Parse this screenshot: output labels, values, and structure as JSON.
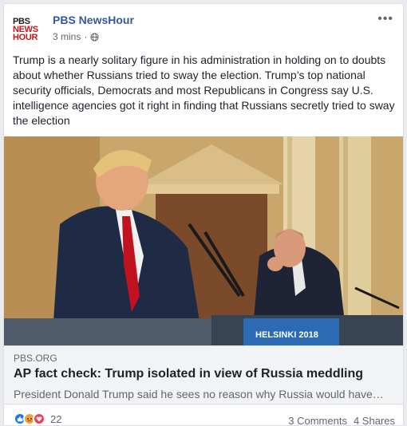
{
  "post": {
    "page_name": "PBS NewsHour",
    "time": "3 mins",
    "separator": "·",
    "logo": {
      "line1": "PBS",
      "line2": "NEWS",
      "line3": "HOUR"
    },
    "text": "Trump is a nearly solitary figure in his administration in holding on to doubts about whether Russians tried to sway the election. Trump’s top national security officials, Democrats and most Republicans in Congress say U.S. intelligence agencies got it right in finding that Russians secretly tried to sway the election",
    "more_label": "•••"
  },
  "media": {
    "banner_text": "HELSINKI 2018"
  },
  "link": {
    "domain": "PBS.ORG",
    "title": "AP fact check: Trump isolated in view of Russia meddling",
    "description": "President Donald Trump said he sees no reason why Russia would have…"
  },
  "footer": {
    "reaction_count": "22",
    "comments": "3 Comments",
    "shares": "4 Shares"
  },
  "colors": {
    "page_link": "#365899",
    "meta_text": "#606770",
    "like": "#1877f2",
    "angry": "#f0a13c",
    "love": "#f33e58"
  }
}
